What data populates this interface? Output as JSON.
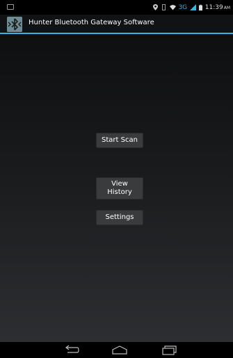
{
  "status_bar": {
    "time": "11:39",
    "ampm": "AM",
    "network": "3G",
    "icons": [
      "notification-icon",
      "location-icon",
      "vibrate-icon",
      "wifi-icon",
      "signal-icon",
      "battery-icon"
    ]
  },
  "action_bar": {
    "title": "Hunter Bluetooth Gateway Software",
    "icon": "bluetooth-app-icon"
  },
  "main": {
    "buttons": {
      "start_scan": "Start Scan",
      "view_history": "View\nHistory",
      "settings": "Settings"
    }
  },
  "nav_bar": {
    "icons": [
      "back-icon",
      "home-icon",
      "recents-icon"
    ]
  },
  "colors": {
    "accent": "#33b5e5",
    "button": "#3a3b3d"
  }
}
